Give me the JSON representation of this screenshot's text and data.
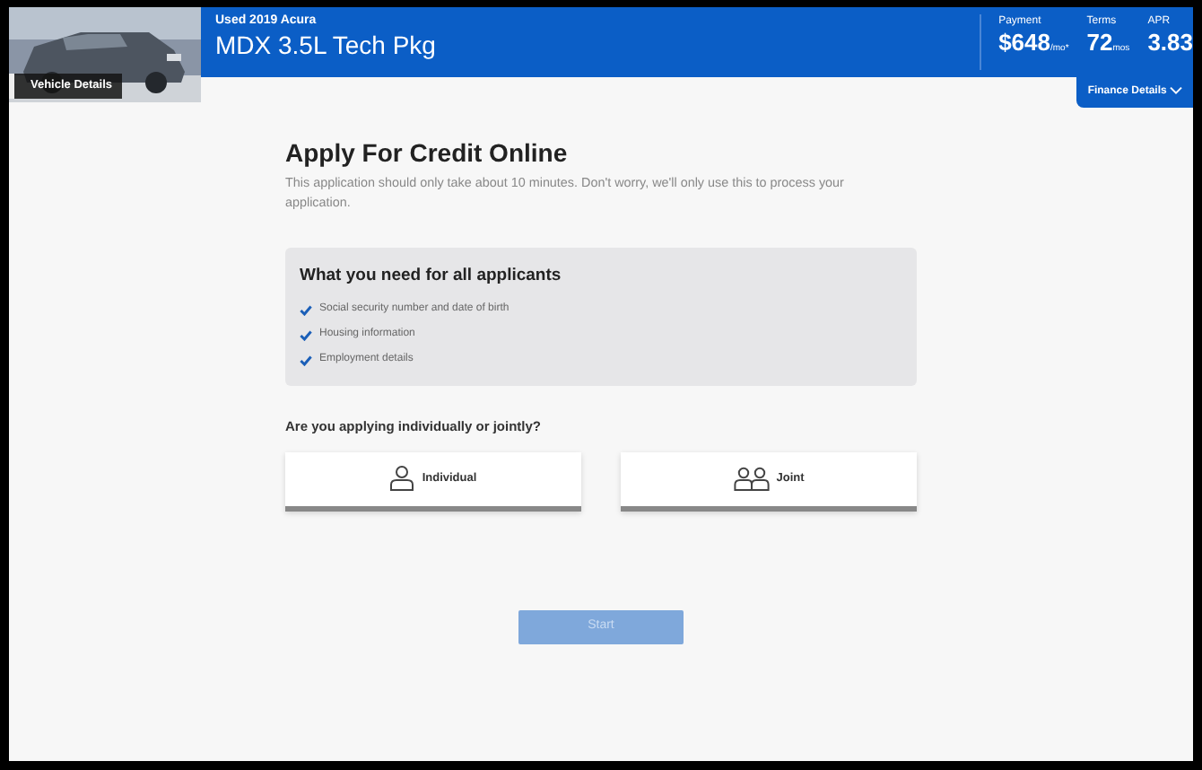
{
  "vehicle": {
    "details_label": "Vehicle Details"
  },
  "header": {
    "subtitle": "Used 2019 Acura",
    "title": "MDX 3.5L Tech Pkg",
    "stats": [
      {
        "label": "Payment",
        "value": "$648",
        "unit": "/mo*"
      },
      {
        "label": "Terms",
        "value": "72",
        "unit": "mos"
      },
      {
        "label": "APR",
        "value": "3.83"
      }
    ],
    "finance_details": "Finance Details"
  },
  "title": "Apply For Credit Online",
  "intro": "This application should only take about 10 minutes. Don't worry, we'll only use this to process your application.",
  "requirements": {
    "heading": "What you need for all applicants",
    "items": [
      {
        "text": "Social security number and date of birth",
        "checked": true
      },
      {
        "text": "Housing information",
        "checked": true
      },
      {
        "text": "Employment details",
        "checked": true
      }
    ]
  },
  "question": "Are you applying individually or jointly?",
  "options": [
    {
      "kind": "single",
      "label": "Individual",
      "selected": false
    },
    {
      "kind": "pair",
      "label": "Joint",
      "selected": false
    }
  ],
  "start": {
    "label": "Start",
    "disabled": true
  }
}
